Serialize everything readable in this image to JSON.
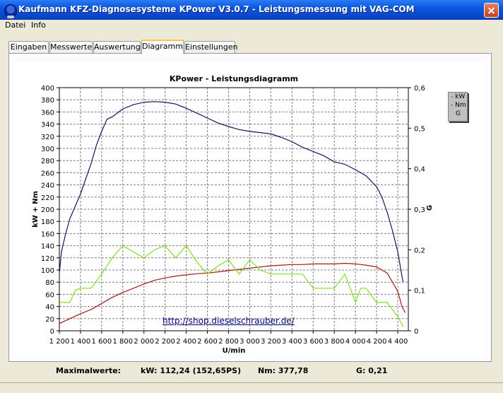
{
  "window": {
    "title": "Kaufmann KFZ-Diagnosesysteme  KPower V3.0.7 - Leistungsmessung mit VAG-COM"
  },
  "menu": {
    "items": [
      "Datei",
      "Info"
    ]
  },
  "tabs": [
    {
      "label": "Eingaben",
      "active": false
    },
    {
      "label": "Messwerte",
      "active": false
    },
    {
      "label": "Auswertung",
      "active": false
    },
    {
      "label": "Diagramm",
      "active": true
    },
    {
      "label": "Einstellungen",
      "active": false
    }
  ],
  "chart_data": {
    "type": "line",
    "title": "KPower - Leistungsdiagramm",
    "xlabel": "U/min",
    "ylabel": "kW + Nm",
    "y2label": "G",
    "xlim": [
      1200,
      4500
    ],
    "ylim": [
      0,
      400
    ],
    "y2lim": [
      0,
      0.6
    ],
    "x_ticks": [
      1200,
      1400,
      1600,
      1800,
      2000,
      2200,
      2400,
      2600,
      2800,
      3000,
      3200,
      3400,
      3600,
      3800,
      4000,
      4200,
      4400
    ],
    "x_tick_labels": [
      "1 200",
      "1 400",
      "1 600",
      "1 800",
      "2 000",
      "2 200",
      "2 400",
      "2 600",
      "2 800",
      "3 000",
      "3 200",
      "3 400",
      "3 600",
      "3 800",
      "4 000",
      "4 200",
      "4 400"
    ],
    "y_ticks": [
      0,
      20,
      40,
      60,
      80,
      100,
      120,
      140,
      160,
      180,
      200,
      220,
      240,
      260,
      280,
      300,
      320,
      340,
      360,
      380,
      400
    ],
    "y2_ticks": [
      0,
      0.1,
      0.2,
      0.3,
      0.4,
      0.5,
      0.6
    ],
    "y2_tick_labels": [
      "0",
      "0,1",
      "0,2",
      "0,3",
      "0,4",
      "0,5",
      "0,6"
    ],
    "grid": true,
    "legend_position": "top-right",
    "series": [
      {
        "name": "kW",
        "axis": "left",
        "color": "#A01818",
        "points": [
          [
            1200,
            12
          ],
          [
            1300,
            20
          ],
          [
            1400,
            28
          ],
          [
            1500,
            35
          ],
          [
            1600,
            45
          ],
          [
            1700,
            55
          ],
          [
            1800,
            63
          ],
          [
            1900,
            70
          ],
          [
            2000,
            77
          ],
          [
            2100,
            83
          ],
          [
            2200,
            87
          ],
          [
            2300,
            90
          ],
          [
            2400,
            92
          ],
          [
            2500,
            94
          ],
          [
            2600,
            95
          ],
          [
            2700,
            97
          ],
          [
            2800,
            99
          ],
          [
            2900,
            101
          ],
          [
            3000,
            103
          ],
          [
            3100,
            105
          ],
          [
            3200,
            107
          ],
          [
            3300,
            108
          ],
          [
            3400,
            109
          ],
          [
            3500,
            109
          ],
          [
            3600,
            110
          ],
          [
            3700,
            110
          ],
          [
            3800,
            110
          ],
          [
            3900,
            111
          ],
          [
            4000,
            110
          ],
          [
            4100,
            108
          ],
          [
            4200,
            105
          ],
          [
            4300,
            95
          ],
          [
            4400,
            65
          ],
          [
            4440,
            40
          ],
          [
            4470,
            30
          ]
        ]
      },
      {
        "name": "Nm",
        "axis": "left",
        "color": "#0A1A5C",
        "points": [
          [
            1200,
            95
          ],
          [
            1220,
            130
          ],
          [
            1260,
            160
          ],
          [
            1300,
            185
          ],
          [
            1350,
            205
          ],
          [
            1400,
            225
          ],
          [
            1450,
            250
          ],
          [
            1500,
            275
          ],
          [
            1550,
            305
          ],
          [
            1600,
            328
          ],
          [
            1650,
            348
          ],
          [
            1700,
            352
          ],
          [
            1800,
            365
          ],
          [
            1900,
            372
          ],
          [
            2000,
            376
          ],
          [
            2100,
            377
          ],
          [
            2200,
            376
          ],
          [
            2300,
            373
          ],
          [
            2400,
            366
          ],
          [
            2500,
            358
          ],
          [
            2600,
            350
          ],
          [
            2700,
            342
          ],
          [
            2800,
            336
          ],
          [
            2900,
            331
          ],
          [
            3000,
            328
          ],
          [
            3100,
            326
          ],
          [
            3200,
            324
          ],
          [
            3300,
            318
          ],
          [
            3400,
            311
          ],
          [
            3500,
            302
          ],
          [
            3600,
            295
          ],
          [
            3700,
            288
          ],
          [
            3800,
            278
          ],
          [
            3900,
            274
          ],
          [
            4000,
            265
          ],
          [
            4100,
            255
          ],
          [
            4200,
            237
          ],
          [
            4250,
            220
          ],
          [
            4300,
            195
          ],
          [
            4350,
            165
          ],
          [
            4400,
            130
          ],
          [
            4430,
            100
          ],
          [
            4450,
            80
          ]
        ]
      },
      {
        "name": "G",
        "axis": "right",
        "color": "#80E020",
        "points": [
          [
            1200,
            0.07
          ],
          [
            1300,
            0.07
          ],
          [
            1350,
            0.1
          ],
          [
            1400,
            0.105
          ],
          [
            1500,
            0.105
          ],
          [
            1600,
            0.14
          ],
          [
            1700,
            0.18
          ],
          [
            1800,
            0.21
          ],
          [
            1900,
            0.195
          ],
          [
            2000,
            0.18
          ],
          [
            2100,
            0.2
          ],
          [
            2200,
            0.21
          ],
          [
            2300,
            0.18
          ],
          [
            2400,
            0.21
          ],
          [
            2500,
            0.17
          ],
          [
            2600,
            0.14
          ],
          [
            2700,
            0.16
          ],
          [
            2800,
            0.175
          ],
          [
            2900,
            0.14
          ],
          [
            3000,
            0.175
          ],
          [
            3100,
            0.15
          ],
          [
            3200,
            0.14
          ],
          [
            3300,
            0.14
          ],
          [
            3400,
            0.14
          ],
          [
            3500,
            0.14
          ],
          [
            3600,
            0.105
          ],
          [
            3700,
            0.105
          ],
          [
            3800,
            0.105
          ],
          [
            3900,
            0.14
          ],
          [
            4000,
            0.07
          ],
          [
            4050,
            0.105
          ],
          [
            4100,
            0.105
          ],
          [
            4200,
            0.07
          ],
          [
            4300,
            0.07
          ],
          [
            4400,
            0.035
          ],
          [
            4450,
            0.01
          ]
        ]
      }
    ]
  },
  "watermark_url": "http://shop.dieselschrauber.de/",
  "max_values": {
    "label": "Maximalwerte:",
    "kw": "kW: 112,24 (152,65PS)",
    "nm": "Nm: 377,78",
    "g": "G: 0,21"
  }
}
